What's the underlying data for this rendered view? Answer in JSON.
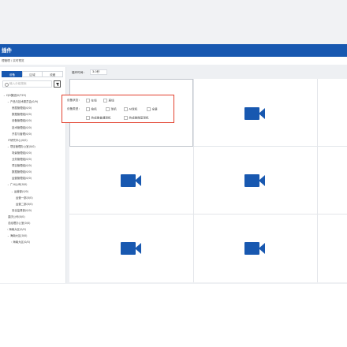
{
  "app": {
    "title": "插件"
  },
  "breadcrumb": {
    "text": "理管理 / 实时预览"
  },
  "sidebar": {
    "tabs": [
      {
        "label": "设备",
        "active": true
      },
      {
        "label": "区域",
        "active": false
      },
      {
        "label": "收藏",
        "active": false
      }
    ],
    "search_placeholder": "输入分组搜索",
    "tree": [
      {
        "label": "CJD集团(0/729)",
        "depth": 0,
        "caret": "⌄"
      },
      {
        "label": "产品与技术委员会(0/9)",
        "depth": 1,
        "caret": "⌄"
      },
      {
        "label": "房屋管理组(0/0)",
        "depth": 2,
        "caret": ""
      },
      {
        "label": "数据管理组(0/0)",
        "depth": 2,
        "caret": ""
      },
      {
        "label": "设备管理组(0/0)",
        "depth": 2,
        "caret": ""
      },
      {
        "label": "技术管理组(0/0)",
        "depth": 2,
        "caret": ""
      },
      {
        "label": "开发与管理(0/0)",
        "depth": 2,
        "caret": ""
      },
      {
        "label": "IT研究中心(0/0)",
        "depth": 1,
        "caret": ""
      },
      {
        "label": "项目管理办公室(0/0)",
        "depth": 1,
        "caret": "⌄"
      },
      {
        "label": "场景管理组(0/0)",
        "depth": 2,
        "caret": ""
      },
      {
        "label": "业务管理组(0/0)",
        "depth": 2,
        "caret": ""
      },
      {
        "label": "项目管理组(0/0)",
        "depth": 2,
        "caret": ""
      },
      {
        "label": "数据管理组(0/0)",
        "depth": 2,
        "caret": ""
      },
      {
        "label": "运营管理组(0/0)",
        "depth": 2,
        "caret": ""
      },
      {
        "label": "广州公司(0/0)",
        "depth": 1,
        "caret": "⌄"
      },
      {
        "label": "运营部(0/0)",
        "depth": 2,
        "caret": "⌄"
      },
      {
        "label": "运营一部(0/0)",
        "depth": 3,
        "caret": ""
      },
      {
        "label": "运营二部(0/0)",
        "depth": 3,
        "caret": ""
      },
      {
        "label": "安全监督部(0/0)",
        "depth": 2,
        "caret": ""
      },
      {
        "label": "重庆公司(0/0)",
        "depth": 1,
        "caret": ""
      },
      {
        "label": "总经理办公室(0/0)",
        "depth": 1,
        "caret": ""
      },
      {
        "label": "海南大区(0/0)",
        "depth": 1,
        "caret": "›"
      },
      {
        "label": "海南大区(0/0)",
        "depth": 1,
        "caret": "⌄"
      },
      {
        "label": "海南大区(0/0)",
        "depth": 2,
        "caret": "›"
      }
    ]
  },
  "toolbar": {
    "label": "循环时间：",
    "select_value": "3.0秒"
  },
  "filter_panel": {
    "row1_label": "设备状态：",
    "row1_options": [
      "在线",
      "离线"
    ],
    "row2_label": "设备类型：",
    "row2_options": [
      "枪机",
      "球机",
      "AI球机",
      "全景"
    ],
    "row3_options": [
      "热成像普通球机",
      "热成像微型球机"
    ]
  },
  "colors": {
    "primary": "#1858b0",
    "highlight_border": "#e2422f"
  },
  "grid_icons": [
    "video-camera-icon",
    "video-camera-icon",
    "video-camera-icon",
    "video-camera-icon",
    "video-camera-icon",
    "video-camera-icon"
  ]
}
